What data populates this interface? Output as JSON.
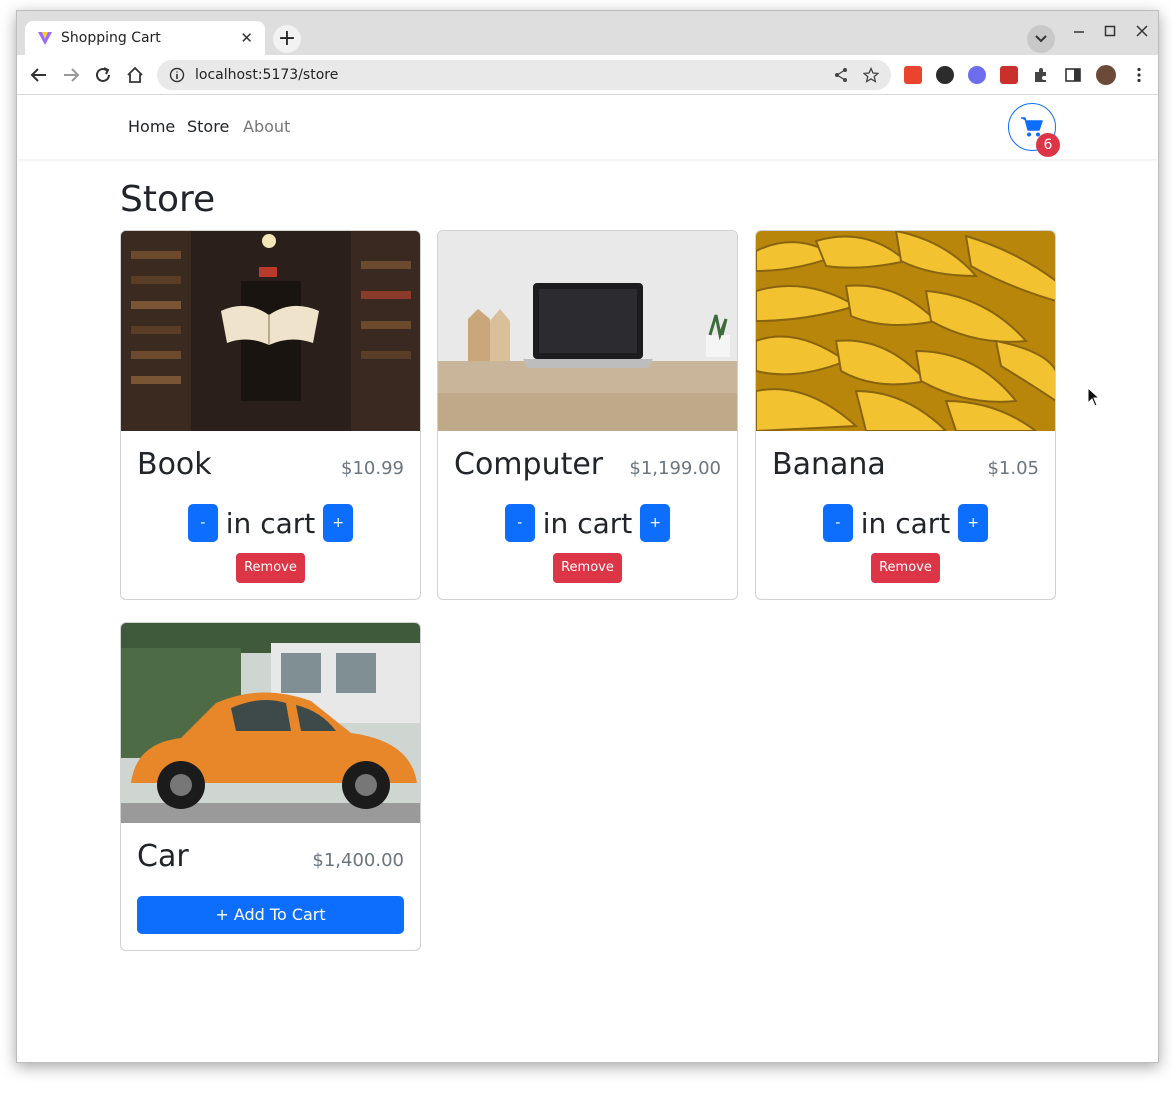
{
  "browser": {
    "tab_title": "Shopping Cart",
    "tab_close": "✕",
    "new_tab": "+",
    "url": "localhost:5173/store"
  },
  "app": {
    "nav": {
      "home": "Home",
      "store": "Store",
      "about": "About"
    },
    "cart_count": "6",
    "page_title": "Store",
    "colors": {
      "primary": "#0d6efd",
      "danger": "#dc3545",
      "muted": "#6c757d"
    }
  },
  "products": [
    {
      "name": "Book",
      "price": "$10.99",
      "in_cart_label": "in cart",
      "minus": "-",
      "plus": "+",
      "remove_label": "Remove"
    },
    {
      "name": "Computer",
      "price": "$1,199.00",
      "in_cart_label": "in cart",
      "minus": "-",
      "plus": "+",
      "remove_label": "Remove"
    },
    {
      "name": "Banana",
      "price": "$1.05",
      "in_cart_label": "in cart",
      "minus": "-",
      "plus": "+",
      "remove_label": "Remove"
    },
    {
      "name": "Car",
      "price": "$1,400.00",
      "add_label": "+ Add To Cart"
    }
  ]
}
